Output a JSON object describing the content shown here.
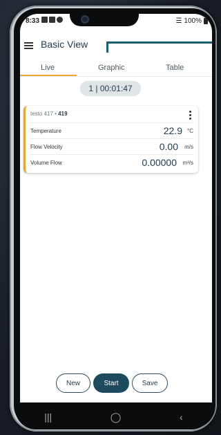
{
  "status_bar": {
    "time": "8:33",
    "battery": "100%"
  },
  "app_bar": {
    "title": "Basic View"
  },
  "tabs": [
    {
      "label": "Live",
      "active": true
    },
    {
      "label": "Graphic",
      "active": false
    },
    {
      "label": "Table",
      "active": false
    }
  ],
  "timer": {
    "text": "1 | 00:01:47"
  },
  "card": {
    "device_name": "testo 417",
    "separator": " • ",
    "device_id": "419",
    "readings": [
      {
        "label": "Temperature",
        "value": "22.9",
        "unit": "°C"
      },
      {
        "label": "Flow Velocity",
        "value": "0.00",
        "unit": "m/s"
      },
      {
        "label": "Volume Flow",
        "value": "0.00000",
        "unit": "m³/s"
      }
    ]
  },
  "actions": {
    "new": "New",
    "start": "Start",
    "save": "Save"
  },
  "nav": {
    "recents": "|||",
    "home": "◯",
    "back": "‹"
  },
  "colors": {
    "accent": "#e8a530",
    "primary": "#1d4b5d"
  }
}
